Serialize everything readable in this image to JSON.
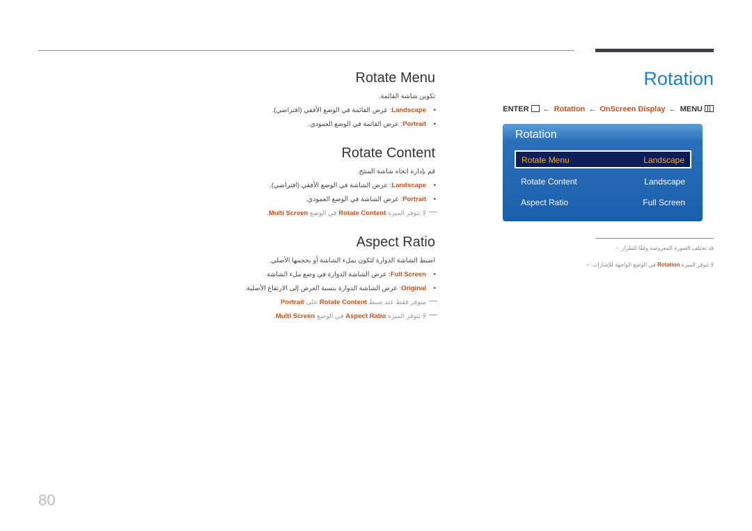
{
  "header": {
    "title": "Rotation",
    "breadcrumb": {
      "enter": "ENTER",
      "arrow": "←",
      "rotation": "Rotation",
      "onscreen": "OnScreen Display",
      "menu": "MENU"
    }
  },
  "osd": {
    "title": "Rotation",
    "rows": [
      {
        "label": "Rotate Menu",
        "value": "Landscape",
        "selected": true
      },
      {
        "label": "Rotate Content",
        "value": "Landscape",
        "selected": false
      },
      {
        "label": "Aspect Ratio",
        "value": "Full Screen",
        "selected": false
      }
    ]
  },
  "side_notes": [
    {
      "text": "قد تختلف الصورة المعروضة وفقًا للطراز."
    },
    {
      "pre": "لا تتوفر الميزة ",
      "bold": "Rotation",
      "post": " في الوضع الواجهة للإشارات."
    }
  ],
  "sections": [
    {
      "heading": "Rotate Menu",
      "intro": "تكوين شاشة القائمة.",
      "bullets": [
        {
          "term": "Landscape",
          "text": ": عرض القائمة في الوضع الأفقي (افتراضي)."
        },
        {
          "term": "Portrait",
          "text": ": عرض القائمة في الوضع العمودي."
        }
      ],
      "notes": []
    },
    {
      "heading": "Rotate Content",
      "intro": "قم بإدارة اتجاه شاشة المنتج.",
      "bullets": [
        {
          "term": "Landscape",
          "text": ": عرض الشاشة في الوضع الأفقي (افتراضي)."
        },
        {
          "term": "Portrait",
          "text": ": عرض الشاشة في الوضع العمودي."
        }
      ],
      "notes": [
        {
          "pre": "لا تتوفر الميزة ",
          "b1": "Rotate Content",
          "mid": " في الوضع ",
          "b2": "Multi Screen",
          "post": "."
        }
      ]
    },
    {
      "heading": "Aspect Ratio",
      "intro": "اضبط الشاشة الدوارة لتكون بملء الشاشة أو بحجمها الأصلي.",
      "bullets": [
        {
          "term": "Full Screen",
          "text": ": عرض الشاشة الدوارة في وضع ملء الشاشة."
        },
        {
          "term": "Original",
          "text": ": عرض الشاشة الدوارة بنسبة العرض إلى الارتفاع الأصلية."
        }
      ],
      "notes": [
        {
          "pre": "متوفر فقط عند ضبط ",
          "b1": "Rotate Content",
          "mid": " على ",
          "b2": "Portrait",
          "post": "."
        },
        {
          "pre": "لا تتوفر الميزة ",
          "b1": "Aspect Ratio",
          "mid": " في الوضع ",
          "b2": "Multi Screen",
          "post": "."
        }
      ]
    }
  ],
  "footer": {
    "page_number": "80"
  }
}
